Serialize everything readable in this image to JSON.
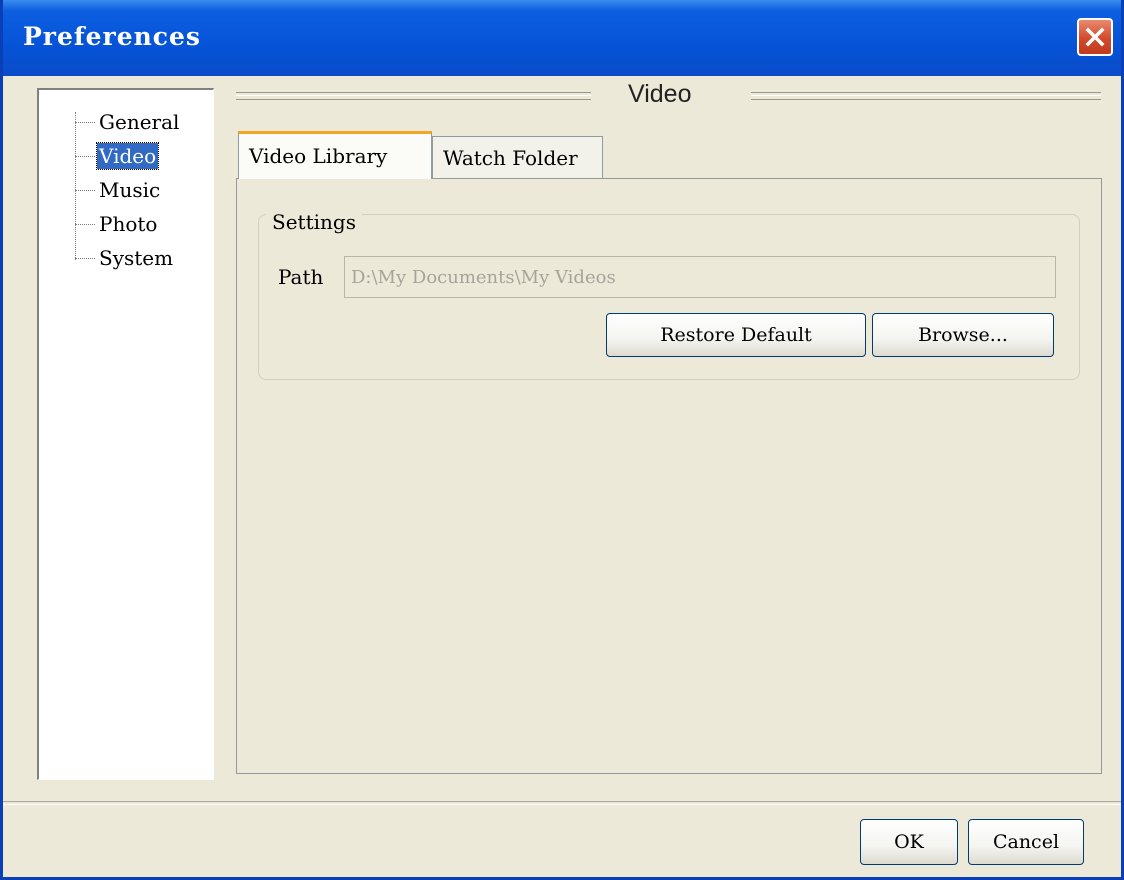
{
  "window": {
    "title": "Preferences"
  },
  "tree": {
    "items": [
      {
        "label": "General",
        "selected": false
      },
      {
        "label": "Video",
        "selected": true
      },
      {
        "label": "Music",
        "selected": false
      },
      {
        "label": "Photo",
        "selected": false
      },
      {
        "label": "System",
        "selected": false
      }
    ]
  },
  "section": {
    "title": "Video"
  },
  "tabs": [
    {
      "label": "Video Library",
      "active": true
    },
    {
      "label": "Watch Folder",
      "active": false
    }
  ],
  "settings": {
    "legend": "Settings",
    "path_label": "Path",
    "path_value": "D:\\My Documents\\My Videos",
    "restore_label": "Restore Default",
    "browse_label": "Browse..."
  },
  "footer": {
    "ok_label": "OK",
    "cancel_label": "Cancel"
  },
  "colors": {
    "titlebar": "#0653d8",
    "selection": "#316ac5",
    "close": "#d24a2c",
    "active_tab_accent": "#f5a623",
    "dialog_bg": "#ece9d8"
  },
  "icons": {
    "close": "close-icon"
  }
}
